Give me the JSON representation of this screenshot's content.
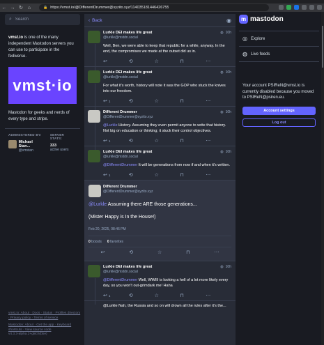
{
  "browser": {
    "url": "https://vmst.io/@DifferentDrummer@syzito.xyz/114035181446426755"
  },
  "left": {
    "search_placeholder": "Search",
    "about_host": "vmst.io",
    "about_text": " is one of the many independent Mastodon servers you can use to participate in the fediverse.",
    "banner_text": "vmst·io",
    "tagline": "Mastodon for geeks and nerds of every type and stripe.",
    "admin_heading": "ADMINISTERED BY:",
    "admin_name": "Michael Stan...",
    "admin_handle": "@vmstan",
    "stats_heading": "SERVER STATS:",
    "stats_num": "333",
    "stats_label": "active users",
    "footer1": "vmst.io: About · Docs · Status · Profiles directory · Privacy policy · Terms of service",
    "footer2": "Mastodon: About · Get the app · Keyboard shortcuts · View source code",
    "footer3": "v4.3.3-alpha.2+glitch(bbe)"
  },
  "center": {
    "back_label": "Back",
    "statuses": [
      {
        "name": "Lurkle DEI makes life great",
        "handle": "@lurkle@mstdn.social",
        "time": "10h",
        "body": "Well, Ben, we were able to keep that republic for a while, anyway. In the end, the compromises we made at the outset did us in.",
        "replies": "",
        "avatar": "lurkle"
      },
      {
        "name": "Lurkle DEI makes life great",
        "handle": "@lurkle@mstdn.social",
        "time": "10h",
        "body": "For what it's worth, history will note it was the GOP who stuck the knives into our freedom.",
        "replies": "1",
        "avatar": "lurkle"
      },
      {
        "name": "Different Drummer",
        "handle": "@DifferentDrummer@syzito.xyz",
        "time": "10h",
        "mention": "@Lurkle",
        "body": " History.  Assuming they even permit anyone to write that history. Not big on education or thinking; it stuck their control objectives.",
        "replies": "1",
        "avatar": "dd"
      },
      {
        "name": "Lurkle DEI makes life great",
        "handle": "@lurkle@mstdn.social",
        "time": "10h",
        "mention": "@DifferentDrummer",
        "body": " It will be generations from now if and when it's written.",
        "replies": "1",
        "avatar": "lurkle"
      }
    ],
    "detailed": {
      "name": "Different Drummer",
      "handle": "@DifferentDrummer@syzito.xyz",
      "mention": "@Lurkle",
      "body1": "  Assuming there ARE those generations...",
      "body2": "(Mister Happy is In the House!)",
      "timestamp": "Feb 20, 2025, 08:46 PM",
      "boosts_num": "0",
      "boosts_label": "boosts",
      "favs_num": "0",
      "favs_label": "favorites"
    },
    "reply": {
      "name": "Lurkle DEI makes life great",
      "handle": "@lurkle@mstdn.social",
      "time": "10h",
      "mention": "@DifferentDrummer",
      "body": " Well, WWIII is looking a hell of a lot more likely every day, so you won't out-grimdark me! Haha",
      "replies": "1"
    },
    "partial_text": "@Lurkle Nah, the Russia and so on will drown all the rules after it's the..."
  },
  "right": {
    "brand": "mastodon",
    "nav": [
      "Explore",
      "Live feeds"
    ],
    "notice": "Your account PSIRеN@vmst.io is currently disabled because you moved to PSIRеN@psiren.eu.",
    "settings_button": "Account settings",
    "logout_button": "Log out"
  }
}
